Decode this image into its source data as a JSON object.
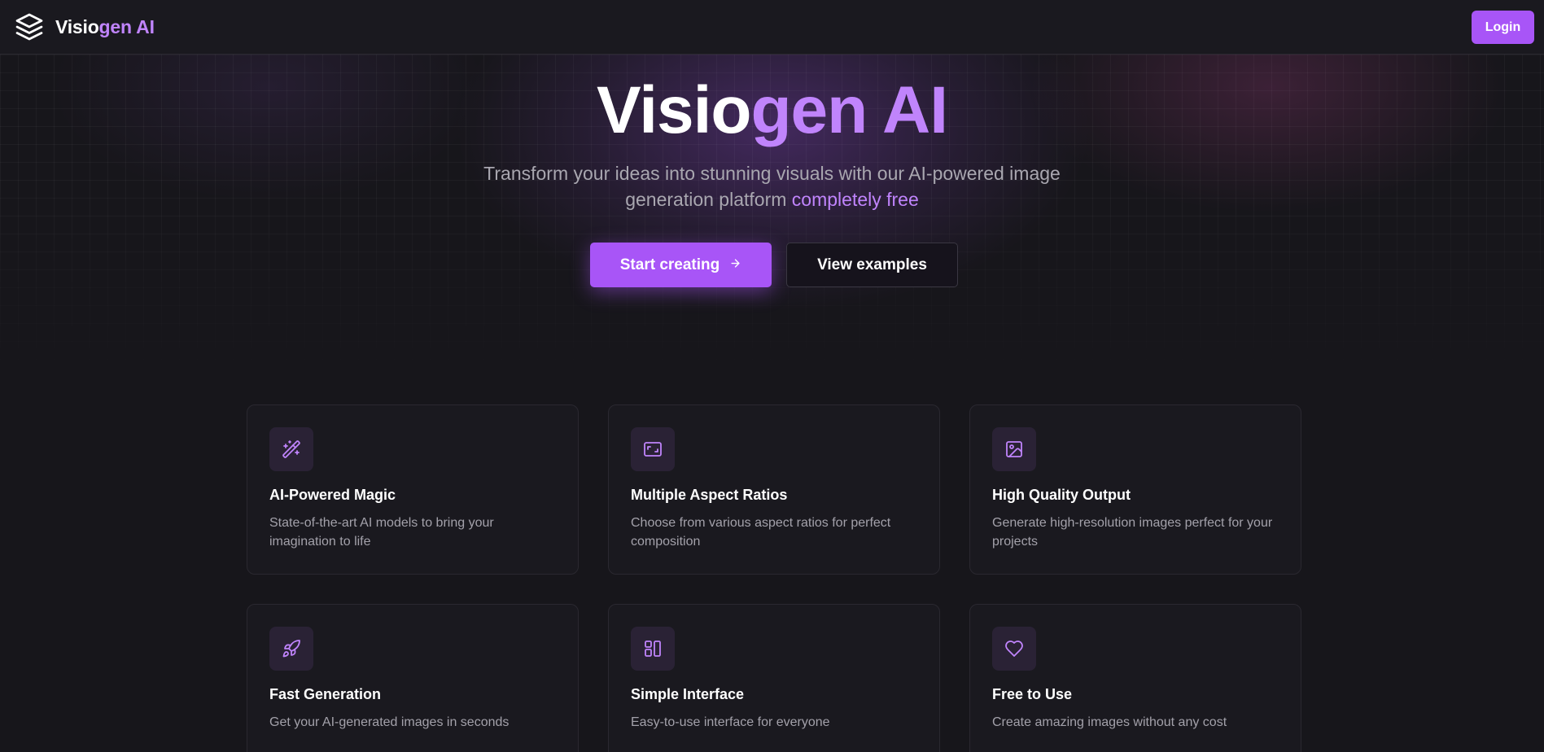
{
  "header": {
    "brand_part1": "Visio",
    "brand_part2": "gen AI",
    "brand_icon": "layers-icon",
    "login_label": "Login"
  },
  "hero": {
    "title_part1": "Visio",
    "title_part2": "gen AI",
    "subtitle_line": "Transform your ideas into stunning visuals with our AI-powered image generation platform",
    "subtitle_highlight": "completely free",
    "primary_button": "Start creating",
    "primary_button_icon": "arrow-right-icon",
    "secondary_button": "View examples"
  },
  "features": [
    {
      "icon": "magic-wand-icon",
      "title": "AI-Powered Magic",
      "description": "State-of-the-art AI models to bring your imagination to life"
    },
    {
      "icon": "aspect-ratio-icon",
      "title": "Multiple Aspect Ratios",
      "description": "Choose from various aspect ratios for perfect composition"
    },
    {
      "icon": "image-icon",
      "title": "High Quality Output",
      "description": "Generate high-resolution images perfect for your projects"
    },
    {
      "icon": "rocket-icon",
      "title": "Fast Generation",
      "description": "Get your AI-generated images in seconds"
    },
    {
      "icon": "layout-icon",
      "title": "Simple Interface",
      "description": "Easy-to-use interface for everyone"
    },
    {
      "icon": "heart-icon",
      "title": "Free to Use",
      "description": "Create amazing images without any cost"
    }
  ],
  "colors": {
    "accent": "#a855f7",
    "accent_light": "#c084fc",
    "background": "#17161b",
    "card": "#1a191f"
  }
}
